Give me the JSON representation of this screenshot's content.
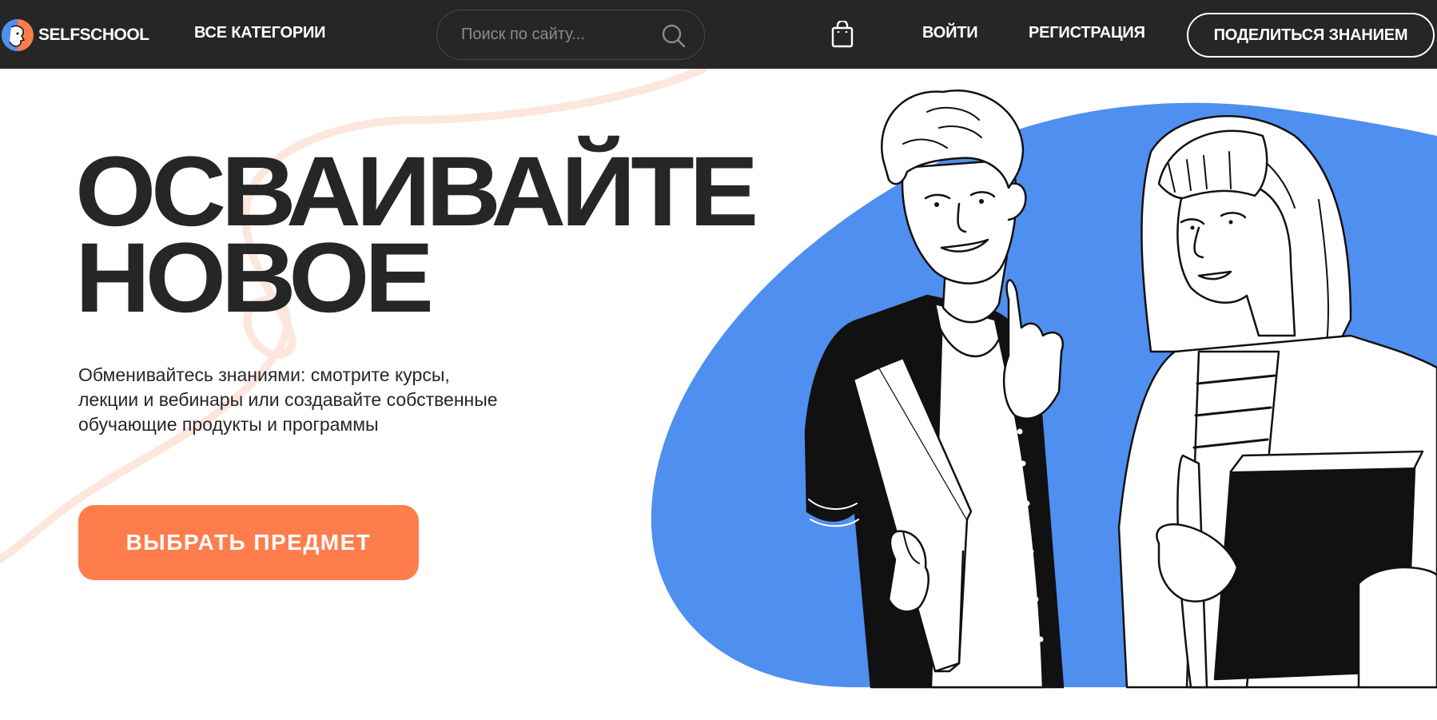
{
  "header": {
    "logo_text": "SELFSCHOOL",
    "all_categories": "ВСЕ КАТЕГОРИИ",
    "search_placeholder": "Поиск по сайту...",
    "login": "ВОЙТИ",
    "register": "РЕГИСТРАЦИЯ",
    "share_knowledge": "ПОДЕЛИТЬСЯ ЗНАНИЕМ"
  },
  "hero": {
    "title_line1": "ОСВАИВАЙТЕ",
    "title_line2": "НОВОЕ",
    "subtitle_line1": "Обменивайтесь знаниями: смотрите курсы,",
    "subtitle_line2": "лекции и вебинары или создавайте собственные",
    "subtitle_line3": "обучающие продукты и программы",
    "cta_label": "ВЫБРАТЬ ПРЕДМЕТ"
  },
  "colors": {
    "header_bg": "#262626",
    "accent_orange": "#ff7d4d",
    "accent_blue": "#4f8ff0",
    "text_dark": "#262626"
  },
  "icons": [
    "logo-mark-icon",
    "search-icon",
    "shopping-bag-icon"
  ]
}
